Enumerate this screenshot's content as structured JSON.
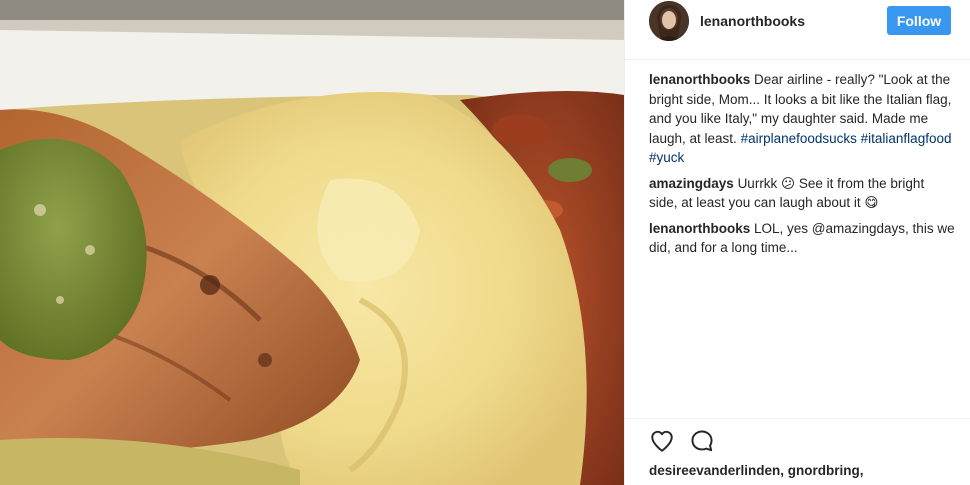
{
  "post": {
    "username": "lenanorthbooks",
    "follow_label": "Follow",
    "photo_alt": "airline-meal-photo"
  },
  "comments": [
    {
      "user": "lenanorthbooks",
      "text": "Dear airline - really? \"Look at the bright side, Mom... It looks a bit like the Italian flag, and you like Italy,\" my daughter said. Made me laugh, at least.",
      "hashtags": "#airplanefoodsucks #italianflagfood #yuck"
    },
    {
      "user": "amazingdays",
      "text": "Uurrkk 😕 See it from the bright side, at least you can laugh about it 😋"
    },
    {
      "user": "lenanorthbooks",
      "text": "LOL, yes @amazingdays, this we did, and for a long time..."
    }
  ],
  "actions": {
    "like_icon": "heart-icon",
    "comment_icon": "comment-icon"
  },
  "likes_text": "desireevanderlinden, gnordbring,",
  "colors": {
    "follow_button": "#3897f0",
    "hashtag": "#003569",
    "text": "#262626",
    "divider": "#efefef"
  }
}
